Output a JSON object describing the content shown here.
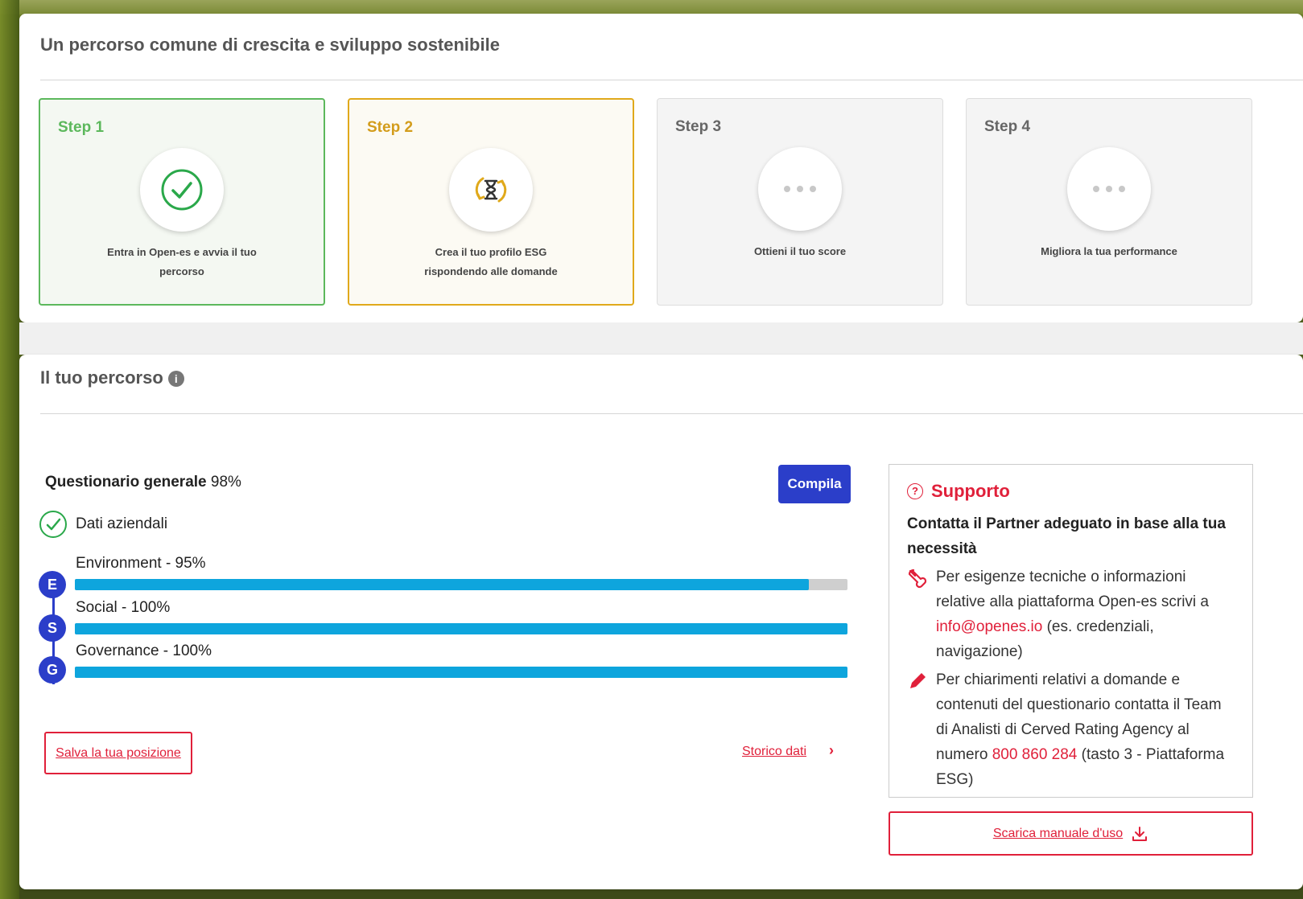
{
  "top": {
    "title": "Un percorso comune di crescita e sviluppo sostenibile",
    "steps": [
      {
        "label": "Step 1",
        "text": "Entra in Open-es e avvia il tuo percorso",
        "status": "done",
        "icon": "check-circle-icon"
      },
      {
        "label": "Step 2",
        "text": "Crea il tuo profilo ESG rispondendo alle domande",
        "status": "active",
        "icon": "hourglass-refresh-icon"
      },
      {
        "label": "Step 3",
        "text": "Ottieni il tuo score",
        "status": "pending",
        "icon": "dots-icon"
      },
      {
        "label": "Step 4",
        "text": "Migliora la tua performance",
        "status": "pending",
        "icon": "dots-icon"
      }
    ]
  },
  "percorso": {
    "title": "Il tuo percorso",
    "questionario_label": "Questionario generale",
    "questionario_percent": "98%",
    "compila": "Compila",
    "dati_aziendali": "Dati aziendali",
    "bars": [
      {
        "letter": "E",
        "label": "Environment - 95%",
        "value": 0.95
      },
      {
        "letter": "S",
        "label": "Social - 100%",
        "value": 1.0
      },
      {
        "letter": "G",
        "label": "Governance - 100%",
        "value": 1.0
      }
    ],
    "salva": "Salva la tua posizione",
    "storico": "Storico dati",
    "chevron": "›"
  },
  "support": {
    "title": "Supporto",
    "subtitle": "Contatta il Partner adeguato in base alla tua necessità",
    "item1_pre": "Per esigenze tecniche o informazioni relative alla piattaforma Open-es scrivi a ",
    "item1_email": "info@openes.io",
    "item1_post": " (es. credenziali, navigazione)",
    "item2_pre": "Per chiarimenti relativi a domande e contenuti del questionario contatta il Team di Analisti di Cerved Rating Agency al numero ",
    "item2_phone": "800 860 284",
    "item2_post": " (tasto 3 - Piattaforma ESG)",
    "download": "Scarica manuale d'uso"
  },
  "colors": {
    "accent_blue": "#2b3ec9",
    "bar_blue": "#0ea5dd",
    "green": "#5cb85c",
    "gold": "#e0a91b",
    "red": "#e0203a"
  }
}
